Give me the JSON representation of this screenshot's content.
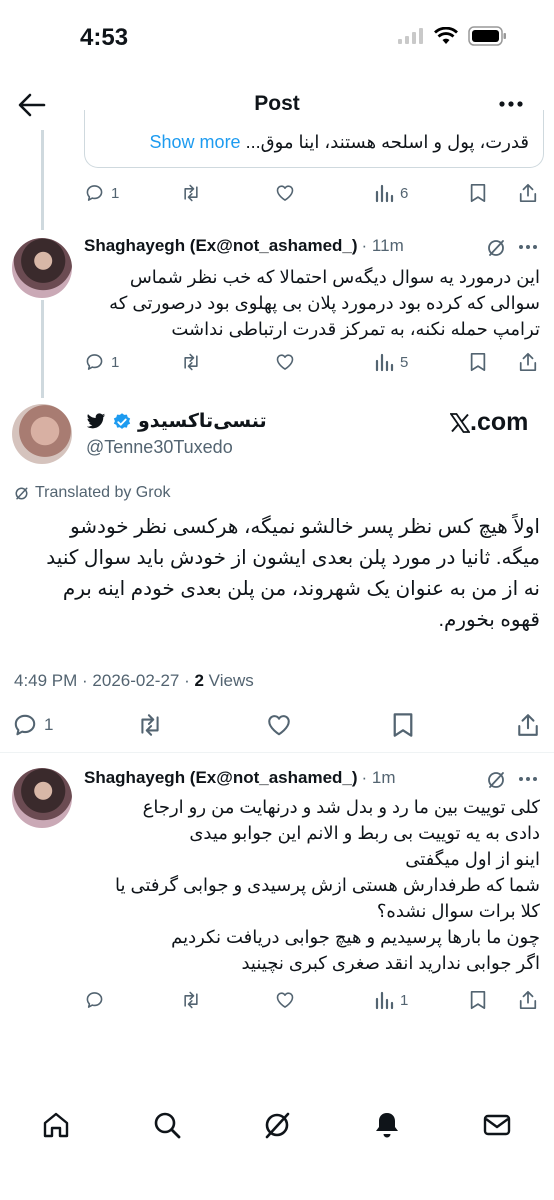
{
  "status_bar": {
    "time": "4:53"
  },
  "nav": {
    "title": "Post"
  },
  "quoted_tail": {
    "text": "قدرت، پول و اسلحه هستند، اینا موق...",
    "show_more": "Show more"
  },
  "reply1": {
    "actions": {
      "replies": "1",
      "views": "6"
    }
  },
  "reply2": {
    "author": "Shaghayegh (Ex@not_ashamed_)",
    "time": "· 11m",
    "lines": [
      "این درمورد یه سوال دیگه‌س احتمالا که خب نظر شماس",
      "سوالی که کرده بود درمورد پلان بی پهلوی بود درصورتی که",
      "ترامپ حمله نکنه، به تمرکز قدرت ارتباطی نداشت"
    ],
    "actions": {
      "replies": "1",
      "views": "5"
    }
  },
  "main": {
    "name": "تنسی‌تاکسیدو",
    "handle": "@Tenne30Tuxedo",
    "xcom": ".com",
    "translated": "Translated by Grok",
    "lines": [
      "اولاً هیچ کس نظر پسر خالشو نمیگه، هرکسی نظر خودشو",
      "میگه. ثانیا در مورد پلن بعدی ایشون از خودش باید سوال کنید",
      "نه از من به عنوان یک شهروند، من پلن بعدی خودم اینه برم",
      "قهوه بخورم."
    ],
    "timestamp": "4:49 PM · 2026-02-27 · ",
    "views_count": "2",
    "views_label": " Views",
    "actions": {
      "replies": "1"
    }
  },
  "reply3": {
    "author": "Shaghayegh (Ex@not_ashamed_)",
    "time": "· 1m",
    "lines": [
      "کلی توییت بین ما رد و بدل شد و درنهایت من رو ارجاع",
      "دادی به یه توییت بی ربط و الانم این جوابو میدی",
      "اینو از اول میگفتی",
      "شما که طرفدارش هستی ازش پرسیدی و جوابی گرفتی یا",
      "کلا برات سوال نشده؟",
      "چون  ما بارها پرسیدیم و هیچ جوابی دریافت نکردیم",
      "اگر جوابی ندارید انقد صغری کبری نچینید"
    ],
    "actions": {
      "views": "1"
    }
  },
  "tabs": [
    "home-icon",
    "search-icon",
    "grok-icon",
    "notifications-icon",
    "messages-icon"
  ],
  "colors": {
    "accent": "#1d9bf0",
    "text": "#0f1419",
    "muted": "#536471",
    "border": "#cfd9de"
  }
}
